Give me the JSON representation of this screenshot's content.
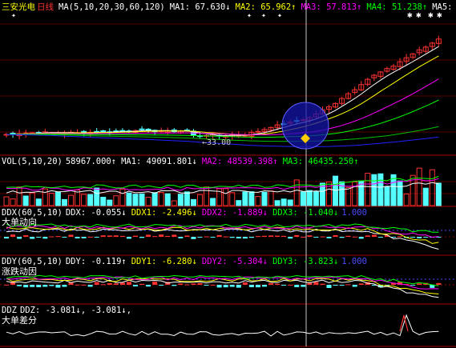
{
  "main": {
    "stock_name": "三安光电",
    "period": "日线",
    "ma_label": "MA(5,10,20,30,60,120)",
    "ma1": "MA1: 67.630↓",
    "ma2": "MA2: 65.962↑",
    "ma3": "MA3: 57.813↑",
    "ma4": "MA4: 51.238↑",
    "ma5": "MA5:",
    "low_price": "33.00",
    "colors": {
      "ma1": "#ffffff",
      "ma2": "#ffff00",
      "ma3": "#ff00ff",
      "ma4": "#00ff00",
      "ma5": "#ffffff",
      "up": "#ff3232",
      "down": "#54ffff"
    }
  },
  "vol": {
    "label": "VOL(5,10,20)",
    "value": "58967.000↑",
    "ma1": "MA1: 49091.801↓",
    "ma2": "MA2: 48539.398↑",
    "ma3": "MA3: 46435.250↑"
  },
  "ddx": {
    "label": "DDX(60,5,10)",
    "ddx": "DDX: -0.055↓",
    "ddx1": "DDX1: -2.496↓",
    "ddx2": "DDX2: -1.889↓",
    "ddx3": "DDX3: -1.040↓",
    "ref": "1.000",
    "title": "大单动向"
  },
  "ddy": {
    "label": "DDY(60,5,10)",
    "ddy": "DDY: -0.119↑",
    "ddy1": "DDY1: -6.280↓",
    "ddy2": "DDY2: -5.304↓",
    "ddy3": "DDY3: -3.823↓",
    "ref": "1.000",
    "title": "涨跌动因"
  },
  "ddz": {
    "label": "DDZ",
    "ddz": "DDZ: -3.081↓, -3.081↓,",
    "title": "大单差分"
  }
}
